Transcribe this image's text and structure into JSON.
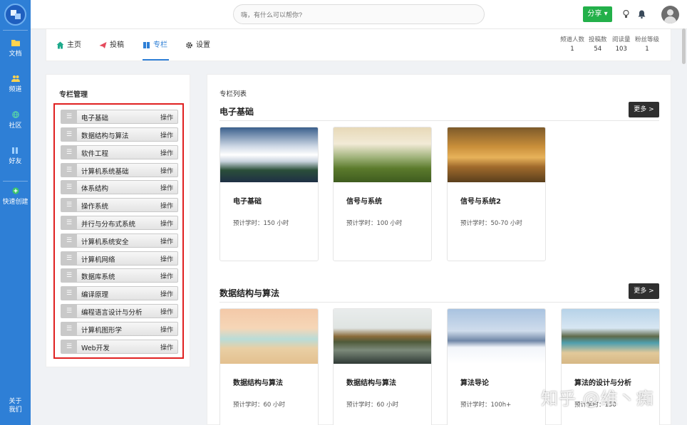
{
  "search": {
    "placeholder": "嗨，有什么可以帮你?"
  },
  "topbar": {
    "share_label": "分享"
  },
  "rail": {
    "items": [
      {
        "label": "文档",
        "icon": "folder-icon"
      },
      {
        "label": "频道",
        "icon": "people-icon"
      },
      {
        "label": "社区",
        "icon": "globe-icon"
      },
      {
        "label": "好友",
        "icon": "friends-icon"
      },
      {
        "label": "快速创建",
        "icon": "plus-circle-icon"
      }
    ],
    "bottom_label_1": "关于",
    "bottom_label_2": "我们"
  },
  "nav": {
    "tabs": [
      {
        "label": "主页",
        "icon": "home-icon"
      },
      {
        "label": "投稿",
        "icon": "send-icon"
      },
      {
        "label": "专栏",
        "icon": "column-icon",
        "active": true
      },
      {
        "label": "设置",
        "icon": "gear-icon"
      }
    ],
    "stats": [
      {
        "label": "频道人数",
        "value": "1"
      },
      {
        "label": "投稿数",
        "value": "54"
      },
      {
        "label": "阅读量",
        "value": "103"
      },
      {
        "label": "粉丝等级",
        "value": "1"
      }
    ]
  },
  "column_manage": {
    "title": "专栏管理",
    "handle_glyph": "☰",
    "op_label": "操作",
    "items": [
      "电子基础",
      "数据结构与算法",
      "软件工程",
      "计算机系统基础",
      "体系结构",
      "操作系统",
      "并行与分布式系统",
      "计算机系统安全",
      "计算机网络",
      "数据库系统",
      "编译原理",
      "编程语言设计与分析",
      "计算机图形学",
      "Web开发"
    ]
  },
  "column_list": {
    "title": "专栏列表",
    "more_label": "更多 >",
    "sections": [
      {
        "title": "电子基础",
        "cards": [
          {
            "name": "电子基础",
            "hours": "预计学时：150 小时"
          },
          {
            "name": "信号与系统",
            "hours": "预计学时：100 小时"
          },
          {
            "name": "信号与系统2",
            "hours": "预计学时：50-70 小时"
          }
        ]
      },
      {
        "title": "数据结构与算法",
        "cards": [
          {
            "name": "数据结构与算法",
            "hours": "预计学时：60 小时"
          },
          {
            "name": "数据结构与算法",
            "hours": "预计学时：60 小时"
          },
          {
            "name": "算法导论",
            "hours": "预计学时：100h+"
          },
          {
            "name": "算法的设计与分析",
            "hours": "预计学时：150"
          }
        ]
      }
    ]
  },
  "watermark": "知乎 @维丶痴",
  "colors": {
    "rail": "#2e7fd6",
    "accent": "#2e7fd6",
    "share": "#23b04a",
    "highlight_box": "#e02020",
    "more_button": "#2f2f2f"
  }
}
